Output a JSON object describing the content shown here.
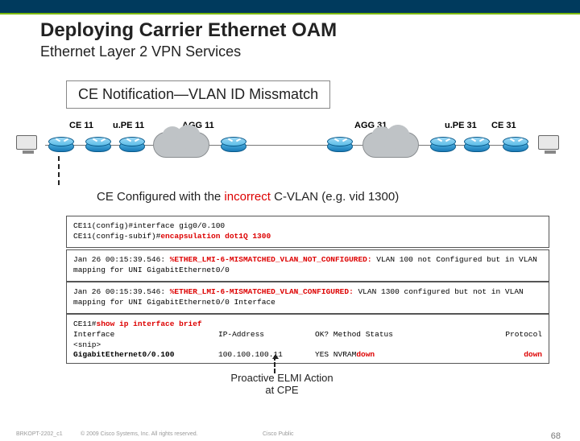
{
  "header": {
    "title": "Deploying Carrier Ethernet OAM",
    "subtitle": "Ethernet Layer 2 VPN Services"
  },
  "badge": "CE Notification—VLAN ID Missmatch",
  "net_labels": {
    "ce11": "CE 11",
    "upe11": "u.PE 11",
    "agg11": "AGG 11",
    "agg31": "AGG 31",
    "upe31": "u.PE 31",
    "ce31": "CE 31"
  },
  "config_line": {
    "pre": "CE Configured with the ",
    "bad": "incorrect",
    "post": " C-VLAN (e.g. vid 1300)"
  },
  "term1": {
    "l1a": "CE11(config)#interface gig0/0.100",
    "l2a": "CE11(config-subif)#",
    "l2b": "encapsulation dot1Q 1300"
  },
  "term2": {
    "ts": "Jan 26 00:15:39.546: ",
    "code": "%ETHER_LMI-6-MISMATCHED_VLAN_NOT_CONFIGURED:",
    "rest": " VLAN 100 not Configured but in VLAN mapping for UNI GigabitEthernet0/0"
  },
  "term3": {
    "ts": "Jan 26 00:15:39.546: ",
    "code": "%ETHER_LMI-6-MISMATCHED_VLAN_CONFIGURED:",
    "rest": " VLAN 1300 configured but not in VLAN mapping for UNI GigabitEthernet0/0 Interface"
  },
  "term4": {
    "l1a": "CE11#",
    "l1b": "show ip interface brief",
    "h1": "Interface",
    "h2": "IP-Address",
    "h3": "OK? Method Status",
    "h4": "Protocol",
    "snip": "<snip>",
    "r1a": "GigabitEthernet0/0.100",
    "r1b": "100.100.100.11",
    "r1c": "YES NVRAM ",
    "r1d": "down",
    "r1e": "down"
  },
  "elmi": {
    "l1": "Proactive ELMI Action",
    "l2": "at CPE"
  },
  "footer": {
    "code": "BRKOPT-2202_c1",
    "copy": "© 2009 Cisco Systems, Inc. All rights reserved.",
    "tag": "Cisco Public",
    "page": "68"
  }
}
